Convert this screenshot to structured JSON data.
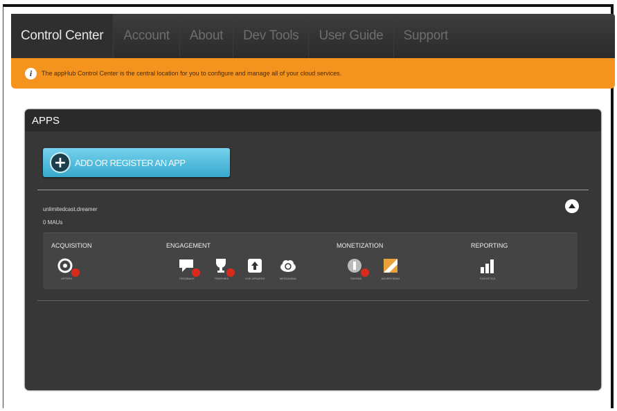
{
  "nav": {
    "items": [
      {
        "label": "Control Center",
        "active": true
      },
      {
        "label": "Account",
        "active": false
      },
      {
        "label": "About",
        "active": false
      },
      {
        "label": "Dev Tools",
        "active": false
      },
      {
        "label": "User Guide",
        "active": false
      },
      {
        "label": "Support",
        "active": false
      }
    ]
  },
  "banner": {
    "icon": "info-icon",
    "text": "The appHub Control Center is the central location for you to configure and manage all of your cloud services."
  },
  "apps_panel": {
    "title": "APPS",
    "add_button_label": "ADD OR REGISTER AN APP",
    "app": {
      "name": "unlimitedcast.dreamer",
      "mau": "0 MAUs"
    },
    "categories": [
      {
        "name": "ACQUISITION",
        "services": [
          {
            "icon": "offers-icon",
            "label": "OFFERS"
          }
        ]
      },
      {
        "name": "ENGAGEMENT",
        "services": [
          {
            "icon": "feedback-icon",
            "label": "FEEDBACK"
          },
          {
            "icon": "trophy-icon",
            "label": "TROPHIES"
          },
          {
            "icon": "updates-icon",
            "label": "LIVE UPDATES"
          },
          {
            "icon": "cloud-icon",
            "label": "MESSAGING"
          }
        ]
      },
      {
        "name": "MONETIZATION",
        "services": [
          {
            "icon": "token-icon",
            "label": "TOKENS"
          },
          {
            "icon": "advertising-icon",
            "label": "ADVERTISING"
          }
        ]
      },
      {
        "name": "REPORTING",
        "services": [
          {
            "icon": "bar-chart-icon",
            "label": "STATISTICS"
          }
        ]
      }
    ]
  }
}
